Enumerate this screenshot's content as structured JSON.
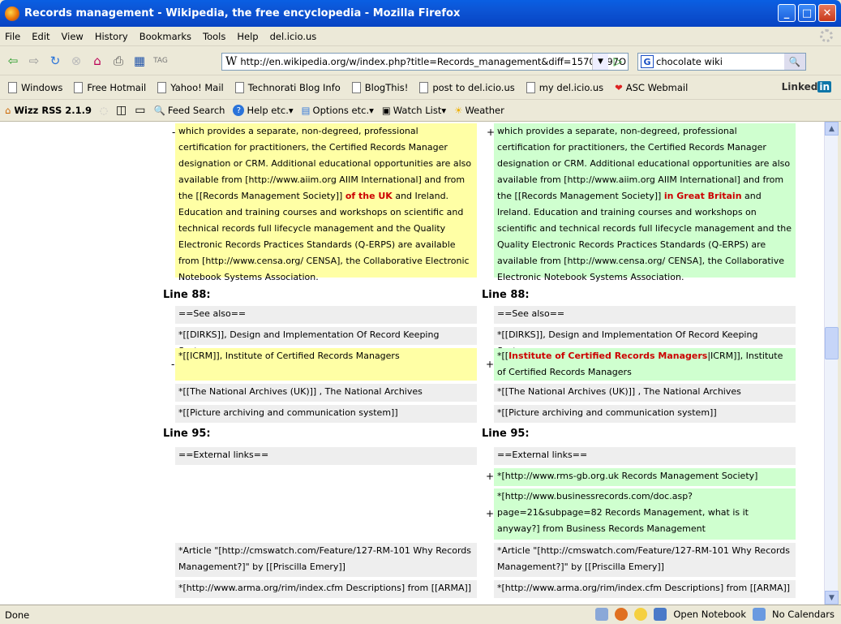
{
  "window": {
    "title": "Records management - Wikipedia, the free encyclopedia - Mozilla Firefox"
  },
  "menu": [
    "File",
    "Edit",
    "View",
    "History",
    "Bookmarks",
    "Tools",
    "Help",
    "del.icio.us"
  ],
  "address": {
    "url": "http://en.wikipedia.org/w/index.php?title=Records_management&diff=15701897O"
  },
  "search": {
    "value": "chocolate wiki"
  },
  "bookmarks": [
    "Windows",
    "Free Hotmail",
    "Yahoo! Mail",
    "Technorati Blog Info",
    "BlogThis!",
    "post to del.icio.us",
    "my del.icio.us",
    "ASC Webmail"
  ],
  "linkedin": {
    "text": "Linked",
    "in": "in"
  },
  "rss": {
    "name": "Wizz RSS 2.1.9",
    "feed_search": "Feed Search",
    "help": "Help etc.",
    "options": "Options etc.",
    "watch": "Watch List",
    "weather": "Weather"
  },
  "diff": {
    "left_para": {
      "pre": "which provides a separate, non-degreed, professional certification for practitioners, the Certified Records Manager designation or CRM. Additional educational opportunities are also available from [http://www.aiim.org AIIM International] and from the [[Records Management Society]] ",
      "del": "of the UK",
      "post": " and Ireland. Education and training courses and workshops on scientific and technical records full lifecycle management and the Quality Electronic Records Practices Standards (Q-ERPS) are available from [http://www.censa.org/ CENSA], the Collaborative Electronic Notebook Systems Association."
    },
    "right_para": {
      "pre": "which provides a separate, non-degreed, professional certification for practitioners, the Certified Records Manager designation or CRM. Additional educational opportunities are also available from [http://www.aiim.org AIIM International] and from the [[Records Management Society]] ",
      "ins": "in Great Britain",
      "post": " and Ireland. Education and training courses and workshops on scientific and technical records full lifecycle management and the Quality Electronic Records Practices Standards (Q-ERPS) are available from [http://www.censa.org/ CENSA], the Collaborative Electronic Notebook Systems Association."
    },
    "line88": "Line 88:",
    "see_also": "==See also==",
    "dirks": "*[[DIRKS]], Design and Implementation Of Record Keeping Systems",
    "icrm_left": "*[[ICRM]], Institute of Certified Records Managers",
    "icrm_right_pre": "*[[",
    "icrm_right_ins": "Institute of Certified Records Managers",
    "icrm_right_post": "|ICRM]], Institute of Certified Records Managers",
    "natarch": "*[[The National Archives (UK)]] , The National Archives",
    "pacs": "*[[Picture archiving and communication system]]",
    "line95": "Line 95:",
    "ext": "==External links==",
    "rms": "*[http://www.rms-gb.org.uk Records Management Society]",
    "busrec": "*[http://www.businessrecords.com/doc.asp?page=21&subpage=82 Records Management, what is it anyway?] from Business Records Management",
    "article": "*Article \"[http://cmswatch.com/Feature/127-RM-101 Why Records Management?]\" by [[Priscilla Emery]]",
    "arma": "*[http://www.arma.org/rim/index.cfm Descriptions] from [[ARMA]]",
    "minus": "-",
    "plus": "+"
  },
  "status": {
    "text": "Done",
    "notebook": "Open Notebook",
    "calendars": "No Calendars"
  }
}
